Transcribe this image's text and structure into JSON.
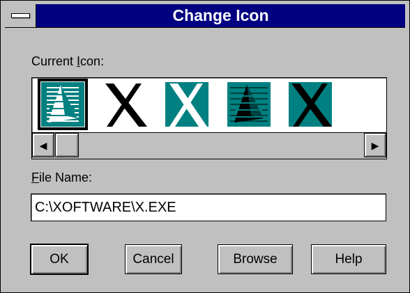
{
  "dialog": {
    "title": "Change Icon",
    "current_icon_label": "Current Icon:",
    "file_name_label": "File Name:",
    "file_name_value": "C:\\XOFTWARE\\X.EXE"
  },
  "icons": [
    {
      "name": "pyramid-teal-icon",
      "selected": true
    },
    {
      "name": "x-black-icon",
      "selected": false
    },
    {
      "name": "x-teal-icon",
      "selected": false
    },
    {
      "name": "pyramid-dark-icon",
      "selected": false
    },
    {
      "name": "x-dark-teal-icon",
      "selected": false
    }
  ],
  "buttons": {
    "ok": "OK",
    "cancel": "Cancel",
    "browse": "Browse",
    "help": "Help"
  },
  "colors": {
    "titlebar": "#000080",
    "face": "#c0c0c0",
    "teal": "#008080"
  }
}
